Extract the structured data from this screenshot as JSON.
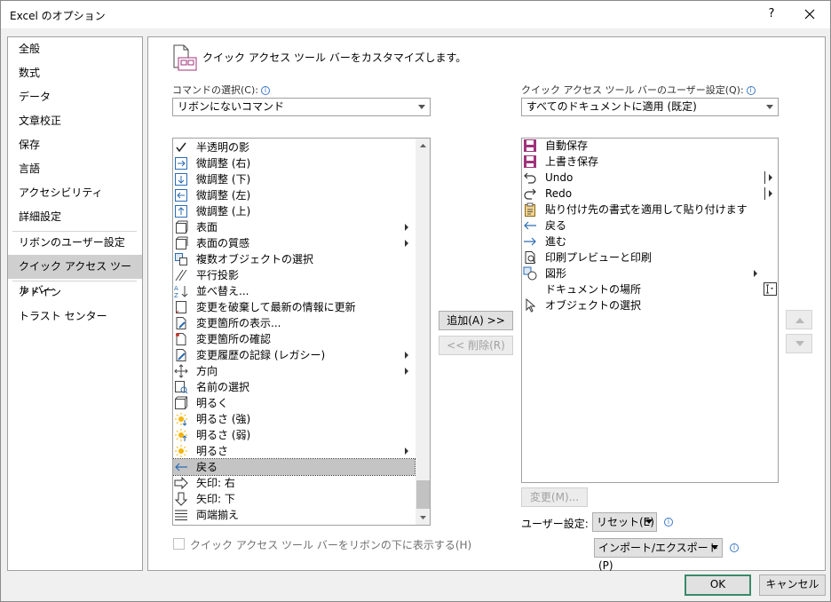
{
  "window": {
    "title": "Excel のオプション",
    "help": "?",
    "close": "✕"
  },
  "nav": {
    "items": [
      {
        "label": "全般"
      },
      {
        "label": "数式"
      },
      {
        "label": "データ"
      },
      {
        "label": "文章校正"
      },
      {
        "label": "保存"
      },
      {
        "label": "言語"
      },
      {
        "label": "アクセシビリティ"
      },
      {
        "label": "詳細設定"
      },
      {
        "label": "リボンのユーザー設定"
      },
      {
        "label": "クイック アクセス ツール バー"
      },
      {
        "label": "アドイン"
      },
      {
        "label": "トラスト センター"
      }
    ],
    "selected": "クイック アクセス ツール バー"
  },
  "main": {
    "header": "クイック アクセス ツール バーをカスタマイズします。",
    "commands_label": "コマンドの選択(C):",
    "commands_value": "リボンにないコマンド",
    "qat_label": "クイック アクセス ツール バーのユーザー設定(Q):",
    "qat_value": "すべてのドキュメントに適用 (既定)",
    "left_items": [
      {
        "label": "半透明の影",
        "icon": "check-icon"
      },
      {
        "label": "微調整 (右)",
        "icon": "nudge-right-icon"
      },
      {
        "label": "微調整 (下)",
        "icon": "nudge-down-icon"
      },
      {
        "label": "微調整 (左)",
        "icon": "nudge-left-icon"
      },
      {
        "label": "微調整 (上)",
        "icon": "nudge-up-icon"
      },
      {
        "label": "表面",
        "icon": "surface-icon",
        "submenu": true
      },
      {
        "label": "表面の質感",
        "icon": "surface-texture-icon",
        "submenu": true
      },
      {
        "label": "複数オブジェクトの選択",
        "icon": "select-objects-icon"
      },
      {
        "label": "平行投影",
        "icon": "parallel-icon"
      },
      {
        "label": "並べ替え...",
        "icon": "sort-icon"
      },
      {
        "label": "変更を破棄して最新の情報に更新",
        "icon": "discard-refresh-icon"
      },
      {
        "label": "変更箇所の表示...",
        "icon": "show-changes-icon"
      },
      {
        "label": "変更箇所の確認",
        "icon": "review-changes-icon"
      },
      {
        "label": "変更履歴の記録 (レガシー)",
        "icon": "track-changes-icon",
        "submenu": true
      },
      {
        "label": "方向",
        "icon": "direction-icon",
        "submenu": true
      },
      {
        "label": "名前の選択",
        "icon": "name-select-icon"
      },
      {
        "label": "明るく",
        "icon": "brighter-icon"
      },
      {
        "label": "明るさ (強)",
        "icon": "brightness-strong-icon"
      },
      {
        "label": "明るさ (弱)",
        "icon": "brightness-weak-icon"
      },
      {
        "label": "明るさ",
        "icon": "brightness-icon",
        "submenu": true
      },
      {
        "label": "戻る",
        "icon": "back-arrow-icon",
        "selected": true
      },
      {
        "label": "矢印: 右",
        "icon": "arrow-right-icon"
      },
      {
        "label": "矢印: 下",
        "icon": "arrow-down-icon"
      },
      {
        "label": "両端揃え",
        "icon": "justify-icon"
      }
    ],
    "right_items": [
      {
        "label": "自動保存",
        "icon": "autosave-icon"
      },
      {
        "label": "上書き保存",
        "icon": "save-icon"
      },
      {
        "label": "Undo",
        "icon": "undo-icon",
        "split": true
      },
      {
        "label": "Redo",
        "icon": "redo-icon",
        "split": true
      },
      {
        "label": "貼り付け先の書式を適用して貼り付けます",
        "icon": "paste-icon"
      },
      {
        "label": "戻る",
        "icon": "back-arrow-icon"
      },
      {
        "label": "進む",
        "icon": "forward-arrow-icon"
      },
      {
        "label": "印刷プレビューと印刷",
        "icon": "print-preview-icon"
      },
      {
        "label": "図形",
        "icon": "shapes-icon",
        "submenu": true
      },
      {
        "label": "ドキュメントの場所",
        "icon": "doc-location-icon",
        "combo": true
      },
      {
        "label": "オブジェクトの選択",
        "icon": "select-cursor-icon"
      }
    ],
    "add_button": "追加(A) >>",
    "remove_button": "<< 削除(R)",
    "modify_button": "変更(M)...",
    "custom_label": "ユーザー設定:",
    "reset_button": "リセット(E)",
    "import_export_button": "インポート/エクスポート(P)",
    "show_below_label": "クイック アクセス ツール バーをリボンの下に表示する(H)",
    "ok": "OK",
    "cancel": "キャンセル"
  }
}
